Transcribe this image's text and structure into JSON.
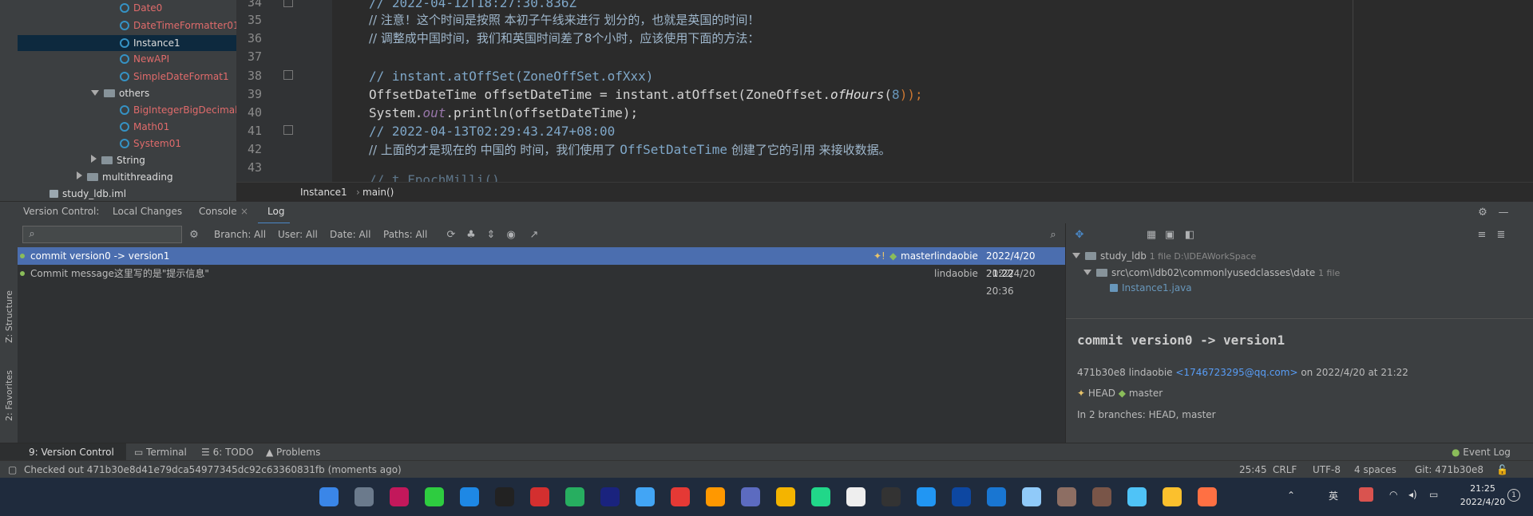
{
  "project_tree": {
    "items": [
      {
        "label": "Date0",
        "style": "red",
        "kind": "class"
      },
      {
        "label": "DateTimeFormatter01",
        "style": "red",
        "kind": "class"
      },
      {
        "label": "Instance1",
        "style": "white",
        "kind": "class",
        "selected": true
      },
      {
        "label": "NewAPI",
        "style": "red",
        "kind": "class"
      },
      {
        "label": "SimpleDateFormat1",
        "style": "red",
        "kind": "class"
      },
      {
        "label": "others",
        "style": "white",
        "kind": "folder-open"
      },
      {
        "label": "BigIntegerBigDecimal",
        "style": "red",
        "kind": "class"
      },
      {
        "label": "Math01",
        "style": "red",
        "kind": "class"
      },
      {
        "label": "System01",
        "style": "red",
        "kind": "class"
      },
      {
        "label": "String",
        "style": "white",
        "kind": "folder-closed"
      },
      {
        "label": "multithreading",
        "style": "white",
        "kind": "folder-closed"
      },
      {
        "label": "study_ldb.iml",
        "style": "white",
        "kind": "file"
      }
    ]
  },
  "editor": {
    "line_numbers": [
      "34",
      "35",
      "36",
      "37",
      "38",
      "39",
      "40",
      "41",
      "42",
      "43"
    ],
    "lines": {
      "l34": "// 2022-04-12T18:27:30.836Z",
      "l35": "// 注意！这个时间是按照 本初子午线来进行 划分的，也就是英国的时间！",
      "l36": "// 调整成中国时间，我们和英国时间差了8个小时，应该使用下面的方法：",
      "l38": "// instant.atOffSet(ZoneOffSet.ofXxx)",
      "l39a": "OffsetDateTime offsetDateTime = instant.atOffset(ZoneOffset.",
      "l39b": "ofHours",
      "l39c": "(",
      "l39d": "8",
      "l39e": "));",
      "l40a": "System.",
      "l40b": "out",
      "l40c": ".println(offsetDateTime);",
      "l41": "// 2022-04-13T02:29:43.247+08:00",
      "l42a": "// 上面的才是现在的 中国的 时间，我们使用了 ",
      "l42b": "OffSetDateTime",
      "l42c": " 创建了它的引用 来接收数据。",
      "l43": "// t.FpochMilli()"
    },
    "breadcrumb": [
      "Instance1",
      "main()"
    ]
  },
  "vc_bar": {
    "title": "Version Control:",
    "tabs": [
      "Local Changes",
      "Console",
      "Log"
    ]
  },
  "vc_toolbar": {
    "search_placeholder": "",
    "filters": [
      "Branch: All",
      "User: All",
      "Date: All",
      "Paths: All"
    ]
  },
  "commits": [
    {
      "message": "commit version0 -> version1",
      "refs": "master",
      "author": "lindaobie",
      "date": "2022/4/20 21:22",
      "selected": true
    },
    {
      "message": "Commit message这里写的是\"提示信息\"",
      "refs": "",
      "author": "lindaobie",
      "date": "2022/4/20 20:36",
      "selected": false
    }
  ],
  "changes": {
    "root": "study_ldb",
    "root_meta": "1 file  D:\\IDEAWorkSpace",
    "dir": "src\\com\\ldb02\\commonlyusedclasses\\date",
    "dir_meta": "1 file",
    "file": "Instance1.java"
  },
  "details": {
    "subject": "commit version0 -> version1",
    "hash_author": "471b30e8 lindaobie",
    "email": "<1746723295@qq.com>",
    "on": "on 2022/4/20 at 21:22",
    "head": "HEAD",
    "branch": "master",
    "branches": "In 2 branches: HEAD, master"
  },
  "side_labels": {
    "structure": "Z: Structure",
    "favorites": "2: Favorites"
  },
  "tool_tabs": [
    "9: Version Control",
    "Terminal",
    "6: TODO",
    "Problems"
  ],
  "event_log": "Event Log",
  "status": {
    "message": "Checked out 471b30e8d41e79dca54977345dc92c63360831fb (moments ago)",
    "position": "25:45",
    "line_sep": "CRLF",
    "encoding": "UTF-8",
    "indent": "4 spaces",
    "git": "Git: 471b30e8"
  },
  "taskbar": {
    "ime": "英",
    "time": "21:25",
    "date": "2022/4/20",
    "app_icons": [
      "windows-icon",
      "settings-icon",
      "intellij-icon",
      "wechat-icon",
      "edge-icon",
      "qq-icon",
      "app-red-icon",
      "app-green-icon",
      "audition-icon",
      "app-blue-icon",
      "wps-icon",
      "sublime-icon",
      "app-purple-icon",
      "folder-icon",
      "pycharm-icon",
      "chat-icon",
      "terminal-icon",
      "app-sky-icon",
      "photoshop-icon",
      "app-feather-icon",
      "app-bird-icon",
      "git-icon",
      "app-avatar-icon",
      "app-monitor-icon",
      "chrome-icon",
      "app-player-icon"
    ]
  },
  "colors": {
    "selection": "#4b6eaf",
    "tree_selection": "#0d293e",
    "taskbar": "#1f2b3d",
    "comment": "#7fa7c8",
    "keyword": "#cc7832"
  }
}
